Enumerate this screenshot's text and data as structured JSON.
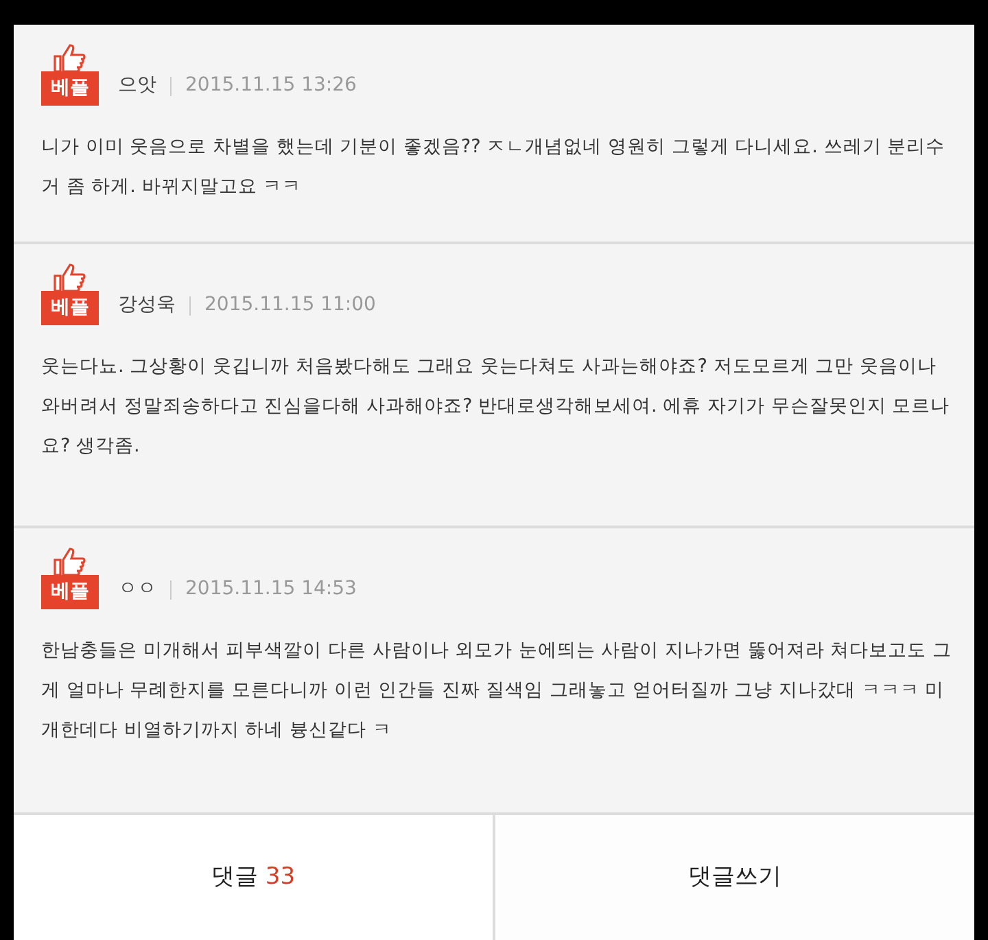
{
  "comments": [
    {
      "badge": "베플",
      "author": "으앗",
      "date": "2015.11.15 13:26",
      "text": "니가 이미 웃음으로 차별을 했는데 기분이 좋겠음?? ㅈㄴ개념없네 영원히 그렇게 다니세요. 쓰레기 분리수거 좀 하게. 바뀌지말고요 ㅋㅋ"
    },
    {
      "badge": "베플",
      "author": "강성욱",
      "date": "2015.11.15 11:00",
      "text": "웃는다뇨. 그상황이 웃깁니까 처음봤다해도 그래요 웃는다쳐도 사과는해야죠? 저도모르게 그만 웃음이나와버려서 정말죄송하다고 진심을다해 사과해야죠? 반대로생각해보세여. 에휴 자기가 무슨잘못인지 모르나요? 생각좀."
    },
    {
      "badge": "베플",
      "author": "ㅇㅇ",
      "date": "2015.11.15 14:53",
      "text": "한남충들은 미개해서 피부색깔이 다른 사람이나 외모가 눈에띄는 사람이 지나가면 뚫어져라 쳐다보고도 그게 얼마나 무례한지를 모른다니까 이런 인간들 진짜 질색임 그래놓고 얻어터질까 그냥 지나갔대 ㅋㅋㅋ 미개한데다 비열하기까지 하네 븅신같다 ㅋ"
    }
  ],
  "footer": {
    "comments_label": "댓글",
    "comments_count": "33",
    "write_label": "댓글쓰기"
  }
}
